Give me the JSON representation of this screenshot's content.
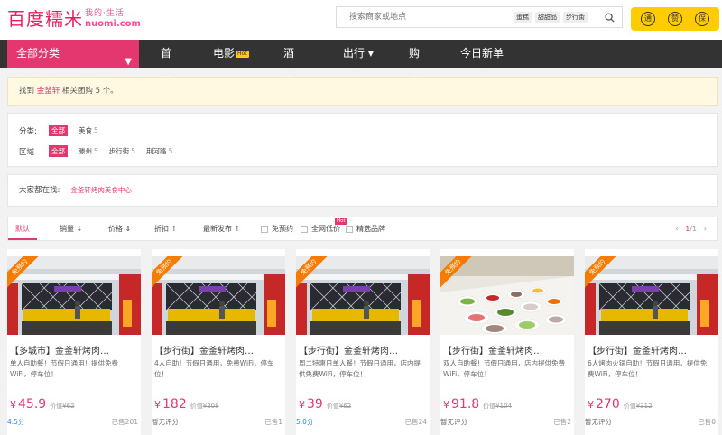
{
  "logo": {
    "cn": "百度糯米",
    "slogan": "我的·生活",
    "en": "nuomi.com"
  },
  "search": {
    "placeholder": "搜索商家或地点",
    "hotwords": [
      "蛋糕",
      "甜甜品",
      "步行街"
    ]
  },
  "badges": [
    "通",
    "赞",
    "保"
  ],
  "nav": {
    "category": "全部分类",
    "items": [
      {
        "label": "首页"
      },
      {
        "label": "电影",
        "tag": "Hot"
      },
      {
        "label": "酒店"
      },
      {
        "label": "出行",
        "caret": "▾"
      },
      {
        "label": "购物"
      },
      {
        "label": "今日新单"
      }
    ]
  },
  "notice": {
    "prefix": "找到 ",
    "keyword": "金釜轩",
    "suffix": " 相关团购 5 个。"
  },
  "filters": {
    "category": {
      "label": "分类:",
      "all": "全部",
      "options": [
        {
          "name": "美食",
          "count": "5"
        }
      ]
    },
    "region": {
      "label": "区域",
      "all": "全部",
      "options": [
        {
          "name": "滕州",
          "count": "5"
        },
        {
          "name": "步行街",
          "count": "5"
        },
        {
          "name": "荆河路",
          "count": "5"
        }
      ]
    }
  },
  "hotsearch": {
    "label": "大家都在找:",
    "keyword": "金釜轩烤肉美食中心"
  },
  "sort": {
    "default": "默认",
    "sales": "销量",
    "price": "价格",
    "discount": "折扣",
    "newest": "最新发布",
    "reserve_free": "免预约",
    "lowest_price": "全网低价",
    "lowest_tag": "Hot",
    "brand": "精选品牌",
    "page_current": "1",
    "page_total": "/1"
  },
  "cards": [
    {
      "ribbon": "免预约",
      "title": "【多城市】金釜轩烤肉…",
      "desc": "单人自助餐！节假日通用！提供免费WiFi，停车位！",
      "price": "45.9",
      "orig_label": "价值",
      "orig": "¥62",
      "rating": "4.5分",
      "sold": "已售201"
    },
    {
      "ribbon": "免预约",
      "title": "【步行街】金釜轩烤肉…",
      "desc": "4人自助！节假日通用，免费WiFi，停车位！",
      "price": "182",
      "orig_label": "价值",
      "orig": "¥208",
      "rating": "暂无评分",
      "sold": "已售1"
    },
    {
      "ribbon": "免预约",
      "title": "【步行街】金釜轩烤肉…",
      "desc": "周二特惠日单人餐！节假日通用，店内提供免费WiFi，停车位！",
      "price": "39",
      "orig_label": "价值",
      "orig": "¥62",
      "rating": "5.0分",
      "sold": "已售24"
    },
    {
      "ribbon": "免预约",
      "title": "【步行街】金釜轩烤肉…",
      "desc": "双人自助餐！节假日通用，店内提供免费WiFi，停车位！",
      "price": "91.8",
      "orig_label": "价值",
      "orig": "¥104",
      "rating": "暂无评分",
      "sold": "已售2"
    },
    {
      "ribbon": "免预约",
      "title": "【步行街】金釜轩烤肉…",
      "desc": "6人烤肉火锅自助！节假日通用，提供免费WiFi，停车位！",
      "price": "270",
      "orig_label": "价值",
      "orig": "¥312",
      "rating": "暂无评分",
      "sold": "已售0"
    }
  ],
  "colors": {
    "accent": "#e5376f",
    "nav": "#333333",
    "badge": "#ffcc00",
    "ribbon": "#f57c00",
    "rating": "#1e88e5"
  }
}
